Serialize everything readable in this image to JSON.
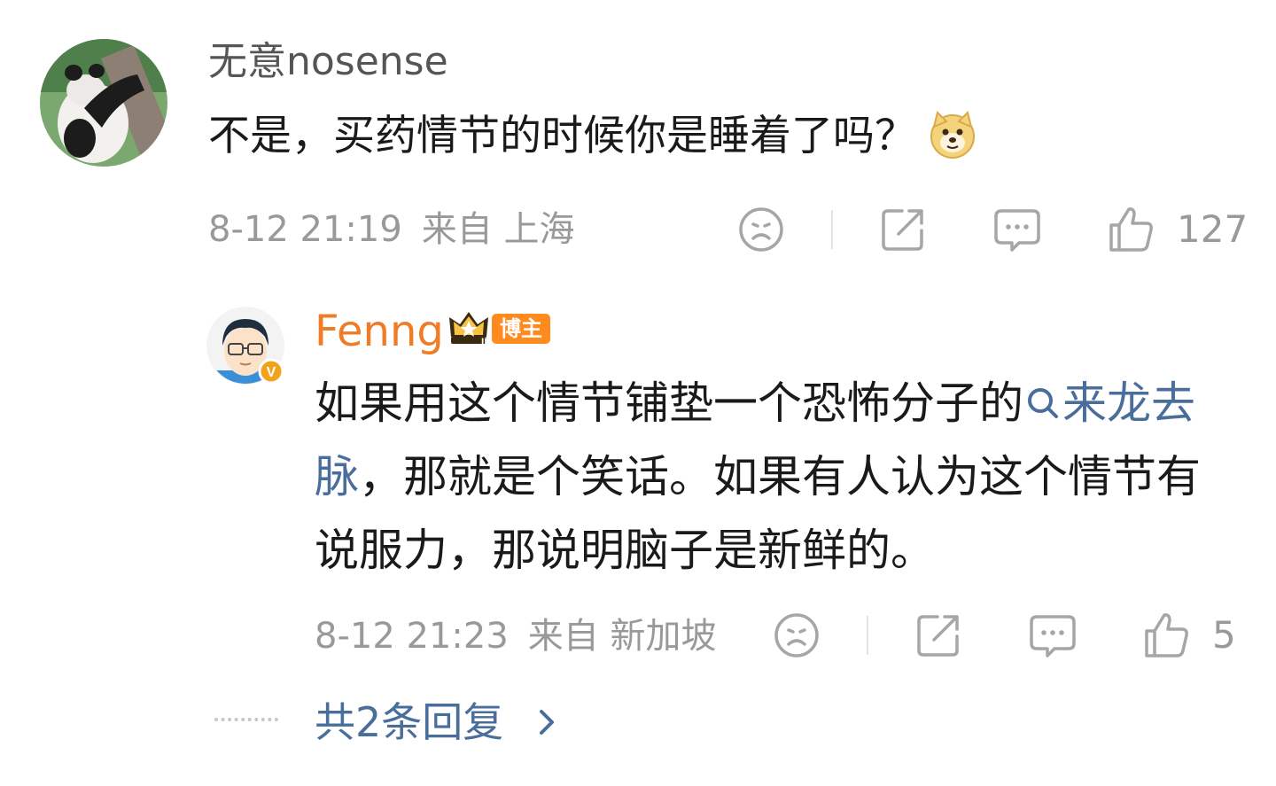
{
  "comment": {
    "username": "无意nosense",
    "text": "不是，买药情节的时候你是睡着了吗？",
    "emoji_icon": "doge-emoji-icon",
    "time": "8-12 21:19",
    "location": "来自 上海",
    "likes": "127"
  },
  "reply": {
    "username": "Fenng",
    "badge_label": "博主",
    "text_before": "如果用这个情节铺垫一个恐怖分子的",
    "topic": "来龙去脉",
    "text_after": "，那就是个笑话。如果有人认为这个情节有说服力，那说明脑子是新鲜的。",
    "time": "8-12 21:23",
    "location": "来自 新加坡",
    "likes": "5"
  },
  "more_replies": "共2条回复",
  "colors": {
    "username_highlight": "#ef7d28",
    "link": "#4a6e9c",
    "muted": "#999999"
  }
}
